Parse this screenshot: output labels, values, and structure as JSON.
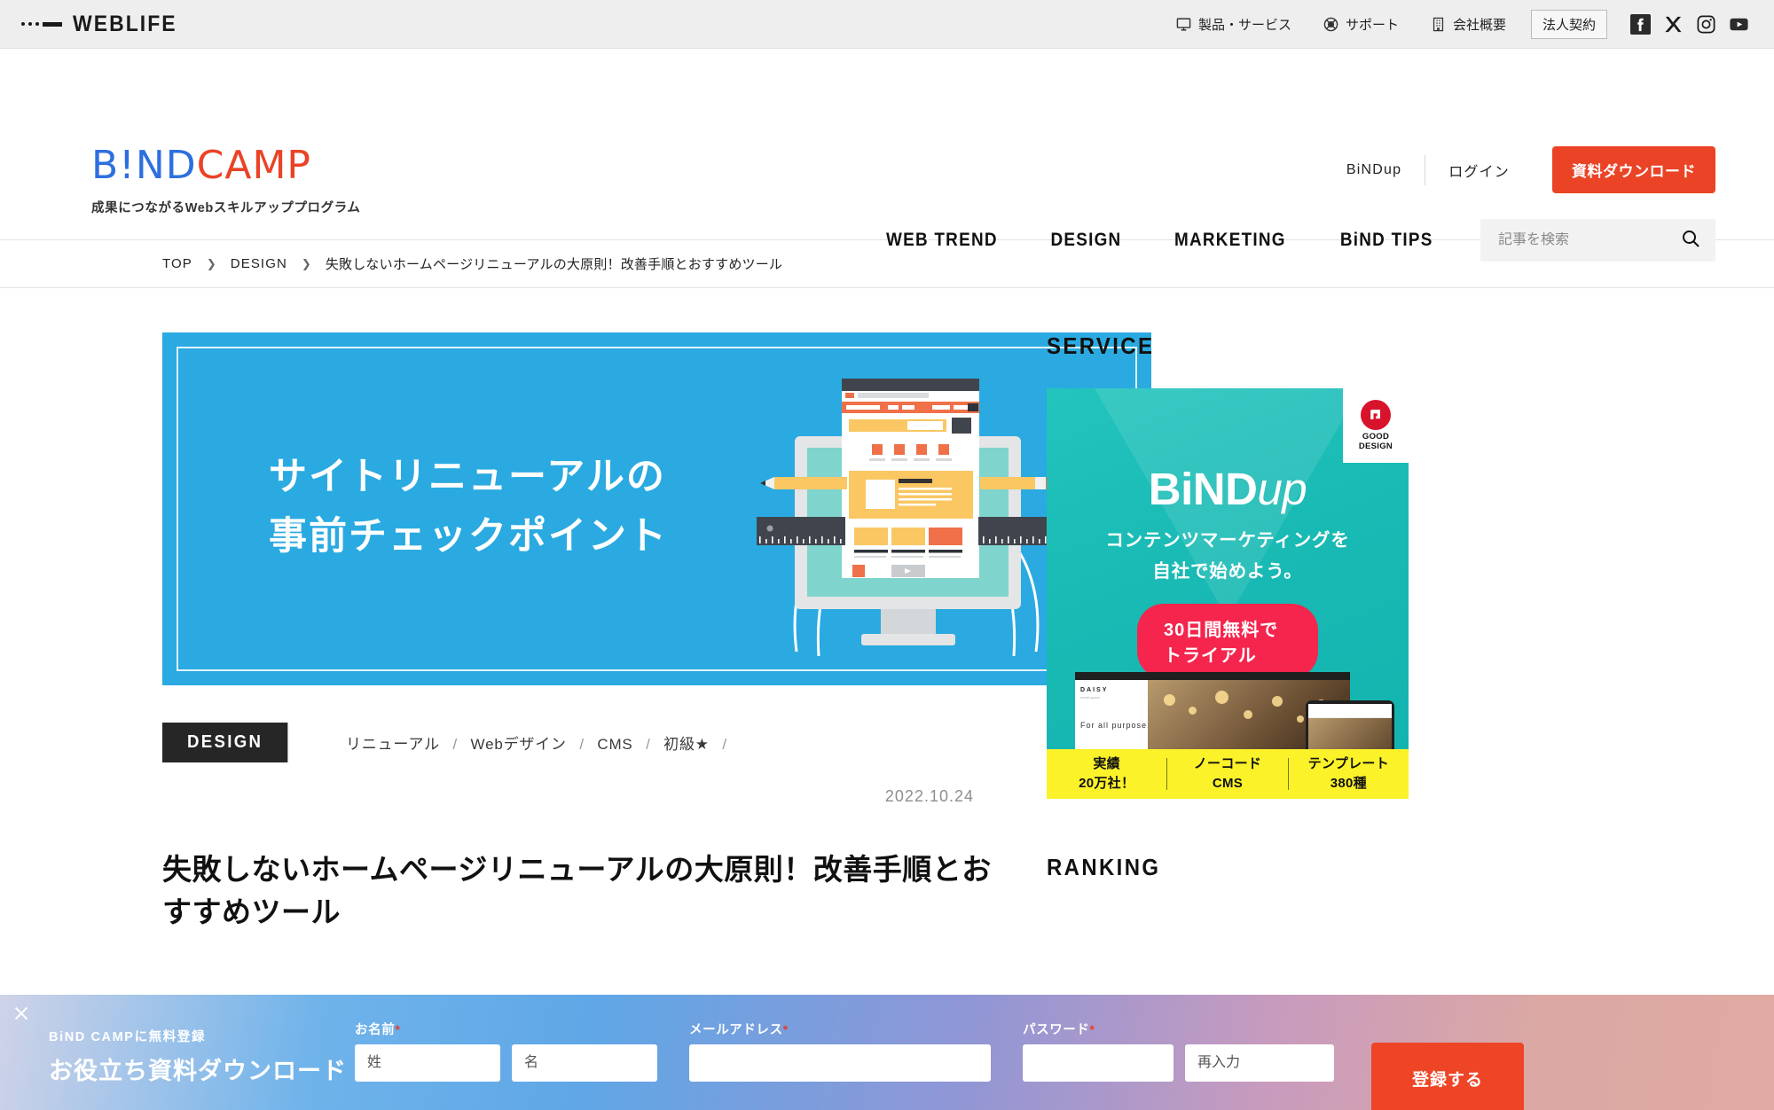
{
  "topbar": {
    "brand": "WEBLIFE",
    "nav": [
      {
        "label": "製品・サービス",
        "icon": "monitor-icon"
      },
      {
        "label": "サポート",
        "icon": "lifebuoy-icon"
      },
      {
        "label": "会社概要",
        "icon": "building-icon"
      }
    ],
    "corporate_button": "法人契約",
    "social": [
      "facebook-icon",
      "x-icon",
      "instagram-icon",
      "youtube-icon"
    ]
  },
  "header": {
    "logo_first": "B!ND",
    "logo_second": "CAMP",
    "tagline": "成果につながるWebスキルアッププログラム",
    "bindup_link": "BiNDup",
    "login_link": "ログイン",
    "download_button": "資料ダウンロード",
    "nav": [
      "WEB TREND",
      "DESIGN",
      "MARKETING",
      "BiND TIPS"
    ],
    "search_placeholder": "記事を検索",
    "search_value": ""
  },
  "breadcrumb": {
    "items": [
      "TOP",
      "DESIGN",
      "失敗しないホームページリニューアルの大原則！改善手順とおすすめツール"
    ],
    "separator": "❯"
  },
  "article": {
    "hero_line1": "サイトリニューアルの",
    "hero_line2": "事前チェックポイント",
    "category": "DESIGN",
    "tags": [
      "リニューアル",
      "Webデザイン",
      "CMS",
      "初級★"
    ],
    "tag_separator": "/",
    "date": "2022.10.24",
    "title": "失敗しないホームページリニューアルの大原則！改善手順とおすすめツール"
  },
  "sidebar": {
    "service_heading": "SERVICE",
    "ranking_heading": "RANKING",
    "ad": {
      "logo_main": "BiND",
      "logo_suffix": "up",
      "copy_line1": "コンテンツマーケティングを",
      "copy_line2": "自社で始めよう。",
      "cta": "30日間無料でトライアル",
      "badge_line1": "GOOD",
      "badge_line2": "DESIGN",
      "shot_brand": "DAISY",
      "shot_brand_sub": "rental space",
      "shot_headline": "For all purpose.",
      "strip": [
        {
          "line1": "実績",
          "line2": "20万社！"
        },
        {
          "line1": "ノーコード",
          "line2": "CMS"
        },
        {
          "line1": "テンプレート",
          "line2": "380種"
        }
      ]
    }
  },
  "signup": {
    "close_icon": "close-icon",
    "kicker": "BiND CAMPに無料登録",
    "title": "お役立ち資料ダウンロード",
    "name_label": "お名前",
    "name_required": "*",
    "last_name_placeholder": "姓",
    "first_name_placeholder": "名",
    "email_label": "メールアドレス",
    "email_required": "*",
    "email_placeholder": "",
    "password_label": "パスワード",
    "password_required": "*",
    "password_placeholder": "",
    "password_confirm_placeholder": "再入力",
    "submit": "登録する"
  },
  "colors": {
    "accent_red": "#ea4326",
    "hero_blue": "#2aaae1",
    "ad_teal": "#19b9b4",
    "ad_cta_pink": "#f5254d",
    "strip_yellow": "#fbf22a",
    "logo_blue": "#2d6fe0"
  }
}
